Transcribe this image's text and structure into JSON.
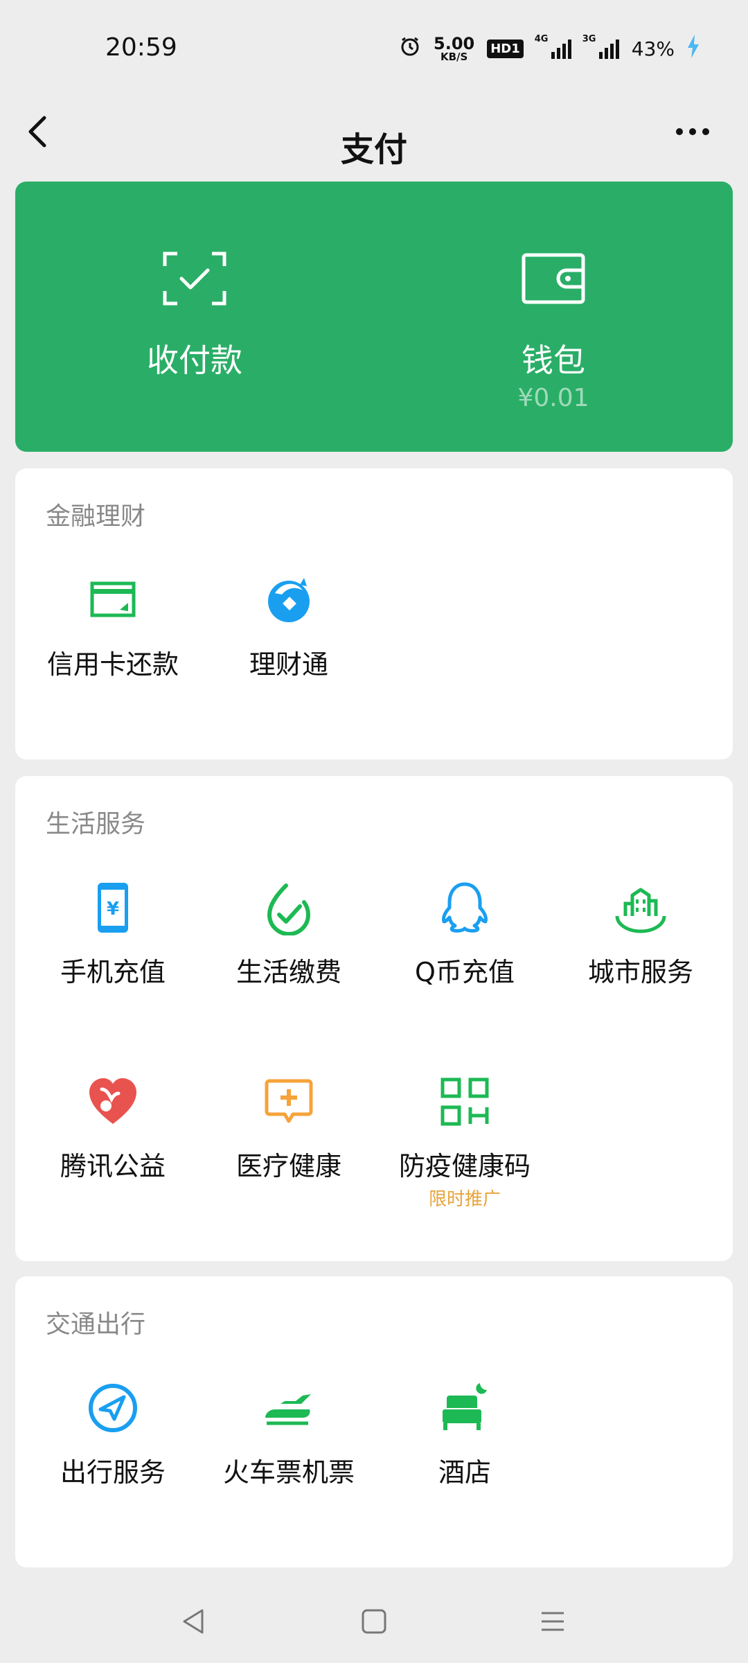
{
  "status": {
    "time": "20:59",
    "speed_value": "5.00",
    "speed_unit": "KB/S",
    "hd": "HD1",
    "sim1": "4G",
    "sim2": "3G",
    "battery": "43%"
  },
  "nav": {
    "title": "支付"
  },
  "hero": {
    "pay_label": "收付款",
    "wallet_label": "钱包",
    "wallet_balance": "¥0.01",
    "bg_color": "#2aae67"
  },
  "finance": {
    "title": "金融理财",
    "items": [
      {
        "label": "信用卡还款",
        "icon": "credit-card-icon"
      },
      {
        "label": "理财通",
        "icon": "licaitong-icon"
      }
    ]
  },
  "life": {
    "title": "生活服务",
    "items": [
      {
        "label": "手机充值",
        "icon": "phone-topup-icon"
      },
      {
        "label": "生活缴费",
        "icon": "bill-payment-icon"
      },
      {
        "label": "Q币充值",
        "icon": "qq-coin-icon"
      },
      {
        "label": "城市服务",
        "icon": "city-service-icon"
      },
      {
        "label": "腾讯公益",
        "icon": "charity-heart-icon"
      },
      {
        "label": "医疗健康",
        "icon": "medical-icon"
      },
      {
        "label": "防疫健康码",
        "icon": "qr-code-icon",
        "promo": "限时推广"
      }
    ]
  },
  "transport": {
    "title": "交通出行",
    "items": [
      {
        "label": "出行服务",
        "icon": "travel-icon"
      },
      {
        "label": "火车票机票",
        "icon": "train-icon"
      },
      {
        "label": "酒店",
        "icon": "hotel-icon"
      }
    ]
  },
  "colors": {
    "green": "#1db954",
    "blue": "#1a9ff0",
    "red": "#e9534f",
    "orange": "#f5a33a",
    "promo": "#e8a33a"
  }
}
